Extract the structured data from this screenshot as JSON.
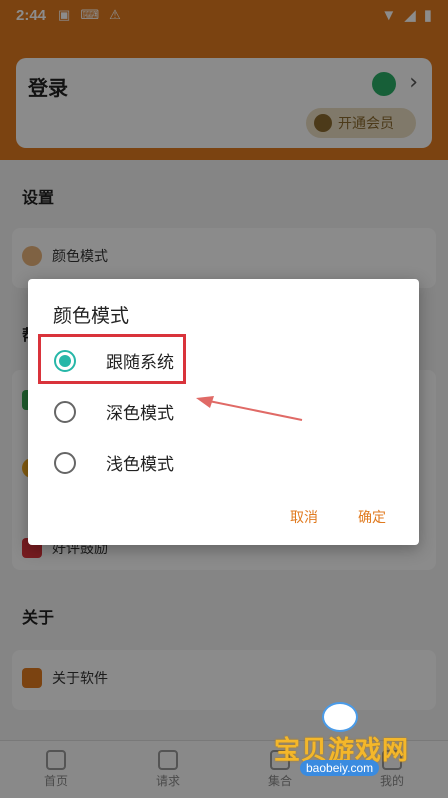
{
  "status_bar": {
    "time": "2:44"
  },
  "profile": {
    "login_label": "登录",
    "vip_button": "开通会员"
  },
  "settings": {
    "section_title": "设置",
    "color_mode_label": "颜色模式"
  },
  "background_rows": {
    "partial_section": "帮",
    "rating_label": "好评鼓励"
  },
  "about": {
    "section_title": "关于",
    "about_software": "关于软件"
  },
  "bottom_nav": [
    {
      "label": "首页"
    },
    {
      "label": "请求"
    },
    {
      "label": "集合"
    },
    {
      "label": "我的"
    }
  ],
  "dialog": {
    "title": "颜色模式",
    "options": [
      {
        "label": "跟随系统",
        "selected": true
      },
      {
        "label": "深色模式",
        "selected": false
      },
      {
        "label": "浅色模式",
        "selected": false
      }
    ],
    "cancel": "取消",
    "confirm": "确定"
  },
  "watermark": {
    "title": "宝贝游戏网",
    "url": "baobeiy.com"
  },
  "colors": {
    "accent": "#e07a1f",
    "radio_checked": "#26b7a8",
    "highlight": "#d9333b"
  }
}
